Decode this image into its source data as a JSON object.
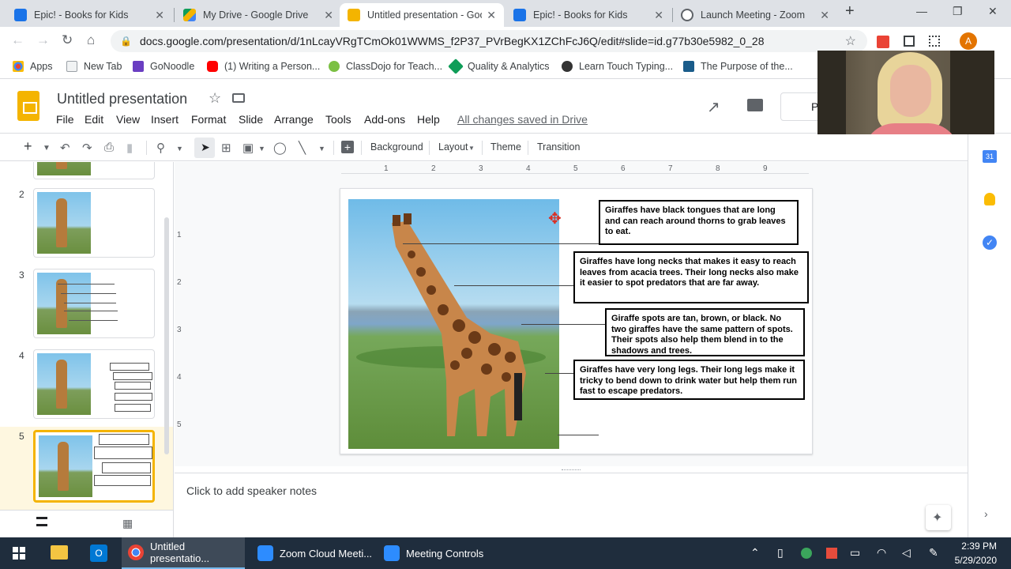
{
  "browser": {
    "tabs": [
      {
        "title": "Epic! - Books for Kids",
        "color": "#1a73e8"
      },
      {
        "title": "My Drive - Google Drive",
        "color": "#0f9d58"
      },
      {
        "title": "Untitled presentation - Goo",
        "color": "#f4b400"
      },
      {
        "title": "Epic! - Books for Kids",
        "color": "#1a73e8"
      },
      {
        "title": "Launch Meeting - Zoom",
        "color": "#5f6368"
      }
    ],
    "new_tab": "+",
    "url": "docs.google.com/presentation/d/1nLcayVRgTCmOk01WWMS_f2P37_PVrBegKX1ZChFcJ6Q/edit#slide=id.g77b30e5982_0_28",
    "profile_initial": "A"
  },
  "bookmarks": [
    {
      "label": "Apps",
      "color": "#ea4335"
    },
    {
      "label": "New Tab",
      "color": "#9aa0a6"
    },
    {
      "label": "GoNoodle",
      "color": "#6a3ec2"
    },
    {
      "label": "(1) Writing a Person...",
      "color": "#ff0000"
    },
    {
      "label": "ClassDojo for Teach...",
      "color": "#7bc043"
    },
    {
      "label": "Quality & Analytics",
      "color": "#0f9d58"
    },
    {
      "label": "Learn Touch Typing...",
      "color": "#333333"
    },
    {
      "label": "The Purpose of the...",
      "color": "#1a5c8a"
    }
  ],
  "app": {
    "title": "Untitled presentation",
    "menus": [
      "File",
      "Edit",
      "View",
      "Insert",
      "Format",
      "Slide",
      "Arrange",
      "Tools",
      "Add-ons",
      "Help"
    ],
    "saved_status": "All changes saved in Drive",
    "present_label": "P"
  },
  "toolbar": {
    "background": "Background",
    "layout": "Layout",
    "theme": "Theme",
    "transition": "Transition"
  },
  "filmstrip": {
    "slides": [
      "2",
      "3",
      "4",
      "5"
    ]
  },
  "rulers": {
    "h": [
      "1",
      "2",
      "3",
      "4",
      "5",
      "6",
      "7",
      "8",
      "9"
    ],
    "v": [
      "1",
      "2",
      "3",
      "4",
      "5"
    ]
  },
  "slide": {
    "callouts": [
      "Giraffes have black tongues that are long and can reach around thorns to grab leaves to eat.",
      "Giraffes have long necks that makes it easy to reach leaves from acacia trees. Their long necks also make it easier to spot predators that are far away.",
      "Giraffe spots are tan, brown, or black.  No two giraffes have the same pattern of spots.  Their spots also help them blend in to the shadows and trees.",
      "Giraffes have very long legs.  Their long legs make it tricky to bend down to drink water but help them run fast to escape predators."
    ]
  },
  "notes": {
    "placeholder": "Click to add speaker notes"
  },
  "taskbar": {
    "apps": [
      {
        "label": "Untitled presentatio...",
        "color": "#f4b400"
      },
      {
        "label": "Zoom Cloud Meeti...",
        "color": "#2d8cff"
      },
      {
        "label": "Meeting Controls",
        "color": "#2d8cff"
      }
    ],
    "time": "2:39 PM",
    "date": "5/29/2020"
  }
}
